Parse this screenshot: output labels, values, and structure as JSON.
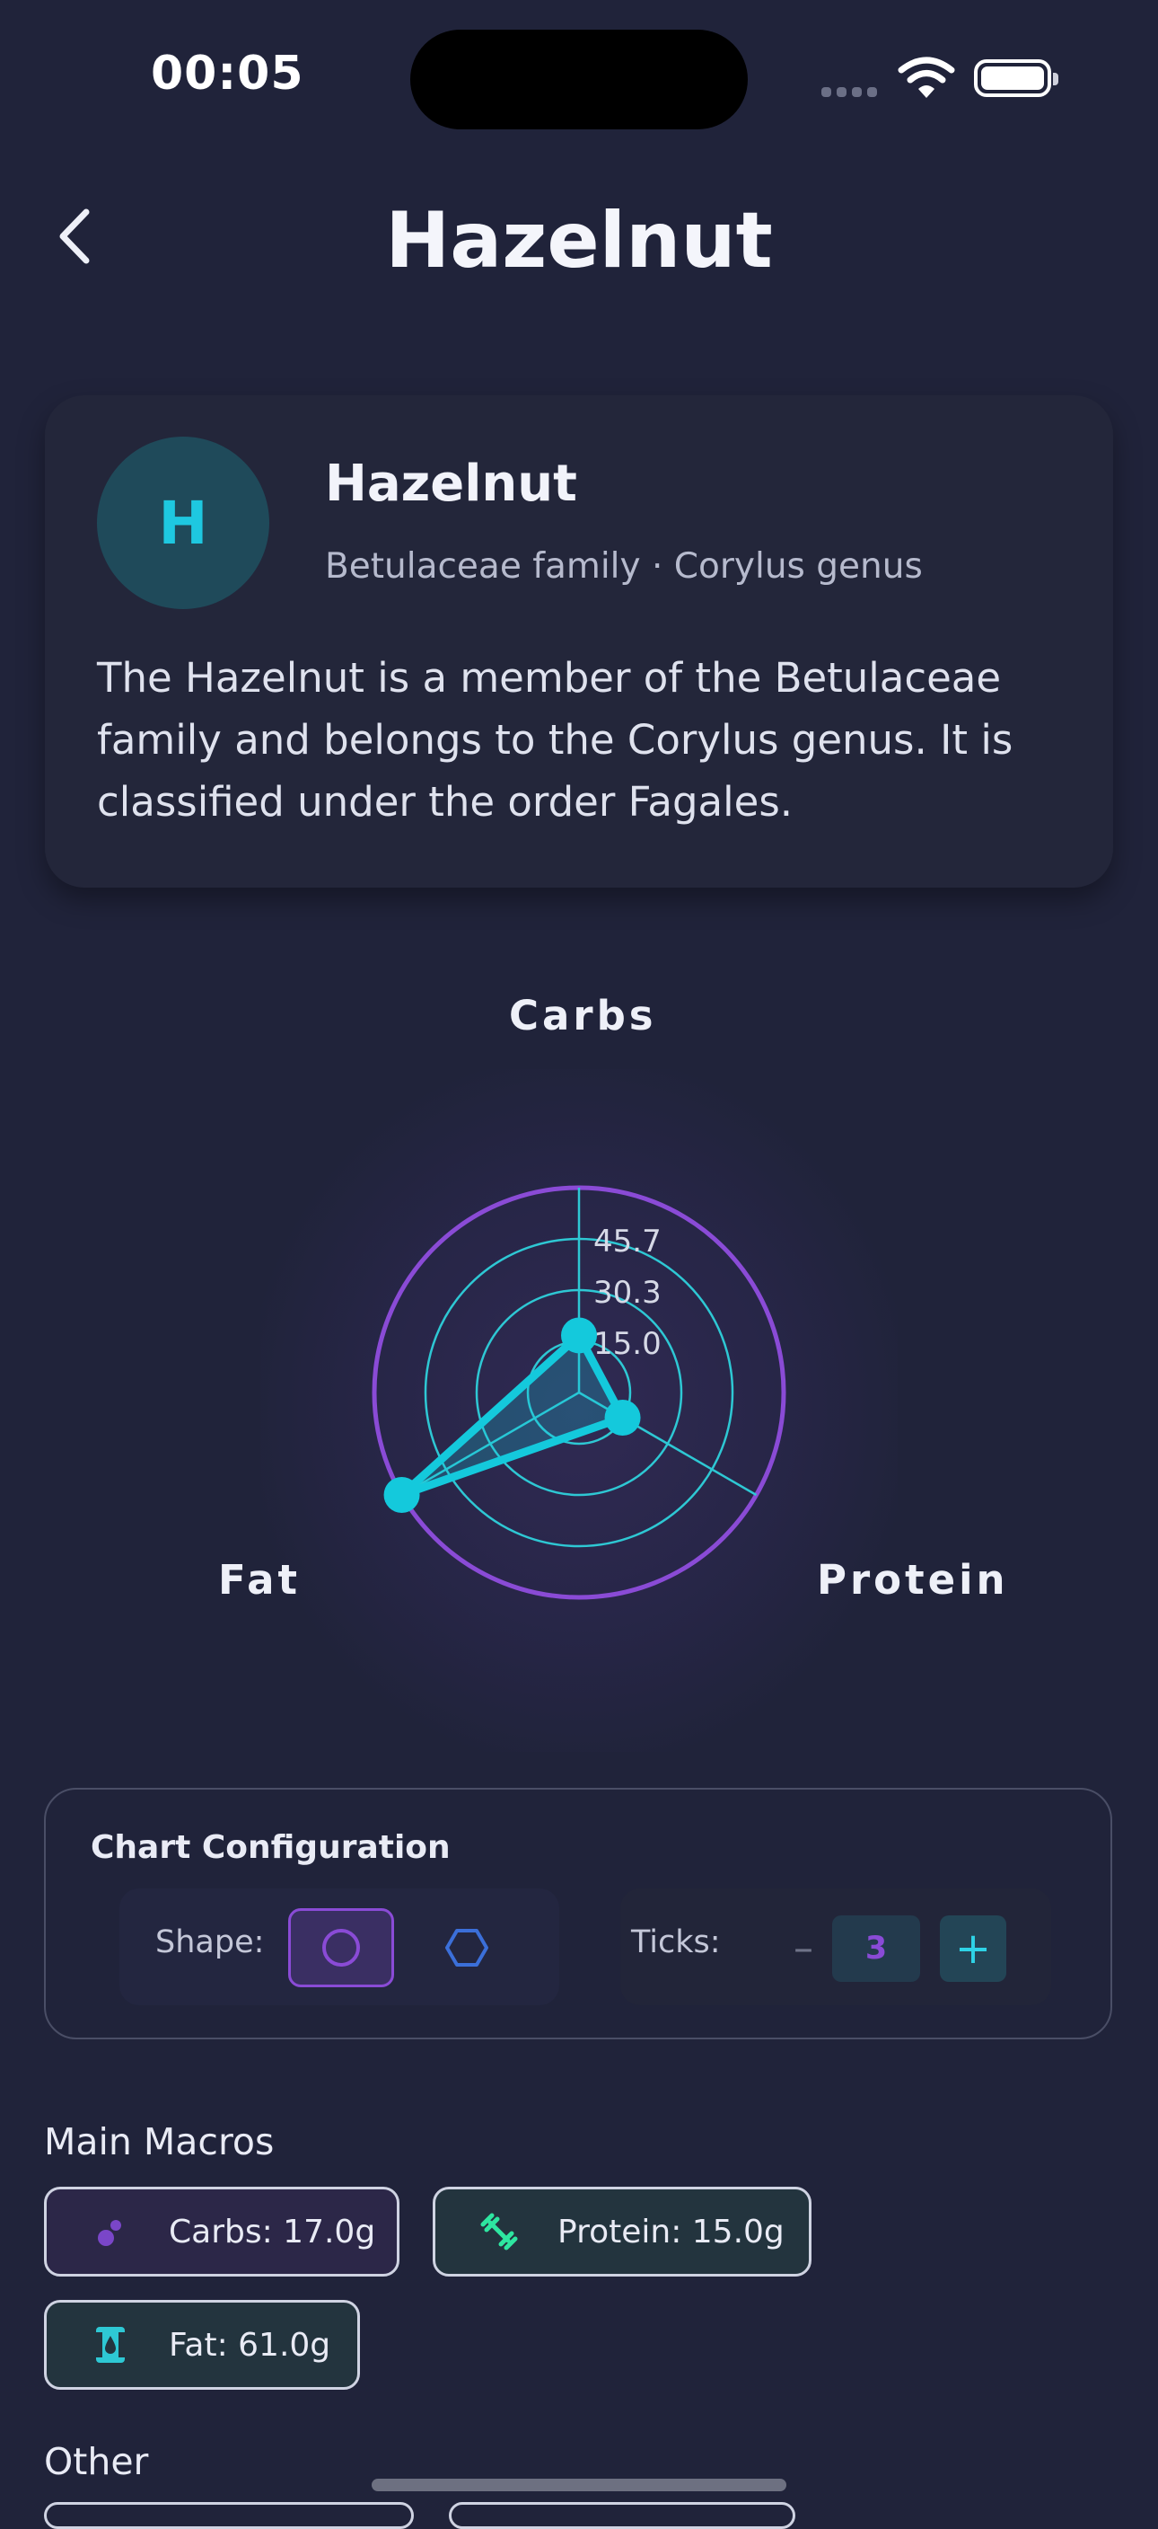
{
  "status_bar": {
    "time": "00:05"
  },
  "header": {
    "title": "Hazelnut",
    "back_icon": "chevron-left-icon"
  },
  "info_card": {
    "avatar_letter": "H",
    "name": "Hazelnut",
    "subtitle": "Betulaceae family · Corylus genus",
    "description": "The Hazelnut is a member of the Betulaceae family and belongs to the Corylus genus. It is classified under the order Fagales."
  },
  "chart_data": {
    "type": "radar",
    "axes": [
      "Carbs",
      "Protein",
      "Fat"
    ],
    "values": [
      17.0,
      15.0,
      61.0
    ],
    "tick_labels": [
      "15.0",
      "30.3",
      "45.7"
    ],
    "max": 61.0,
    "shape": "circle",
    "colors": {
      "series": "#14c9dc",
      "grid": "#2ec8d4",
      "outer": "#8a4bd6"
    }
  },
  "config": {
    "title": "Chart Configuration",
    "shape_label": "Shape:",
    "ticks_label": "Ticks:",
    "ticks_value": "3",
    "minus": "–",
    "plus": "+"
  },
  "macros": {
    "title": "Main Macros",
    "items": [
      {
        "label": "Carbs: 17.0g",
        "icon": "atom-icon"
      },
      {
        "label": "Protein: 15.0g",
        "icon": "dumbbell-icon"
      },
      {
        "label": "Fat: 61.0g",
        "icon": "oil-drop-icon"
      }
    ]
  },
  "other": {
    "title": "Other"
  }
}
